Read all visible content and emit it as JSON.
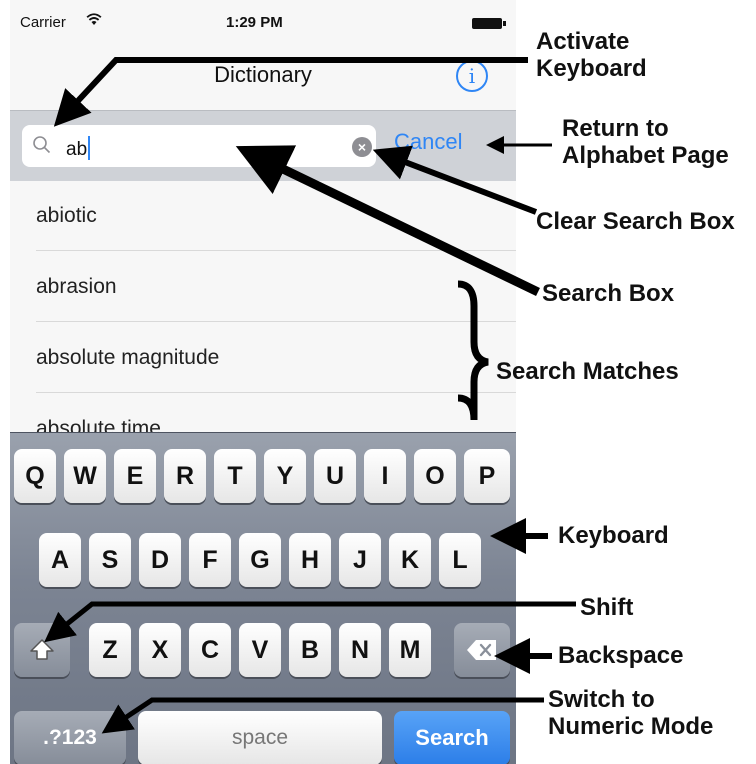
{
  "status": {
    "carrier": "Carrier",
    "time": "1:29 PM"
  },
  "nav": {
    "title": "Dictionary"
  },
  "search": {
    "value": "ab",
    "cancel": "Cancel"
  },
  "results": [
    "abiotic",
    "abrasion",
    "absolute magnitude",
    "absolute time"
  ],
  "keyboard": {
    "row1": [
      "Q",
      "W",
      "E",
      "R",
      "T",
      "Y",
      "U",
      "I",
      "O",
      "P"
    ],
    "row2": [
      "A",
      "S",
      "D",
      "F",
      "G",
      "H",
      "J",
      "K",
      "L"
    ],
    "row3": [
      "Z",
      "X",
      "C",
      "V",
      "B",
      "N",
      "M"
    ],
    "num": ".?123",
    "space": "space",
    "search": "Search"
  },
  "annotations": {
    "activate": [
      "Activate",
      "Keyboard"
    ],
    "return": [
      "Return to",
      "Alphabet Page"
    ],
    "clear": "Clear Search Box",
    "searchbox": "Search Box",
    "matches": "Search Matches",
    "keyboard": "Keyboard",
    "shift": "Shift",
    "backspace": "Backspace",
    "numeric": [
      "Switch to",
      "Numeric Mode"
    ]
  },
  "icons": [
    "wifi-icon",
    "battery-icon",
    "info-icon",
    "search-icon",
    "clear-icon",
    "shift-icon",
    "backspace-icon"
  ]
}
